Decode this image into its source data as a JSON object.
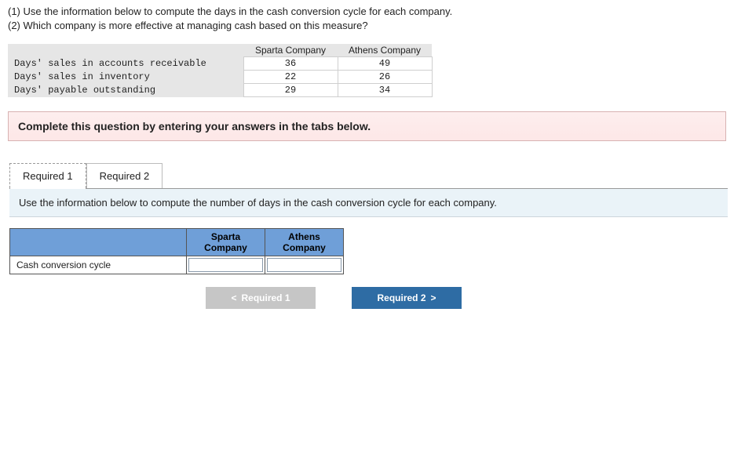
{
  "question": {
    "line1": "(1) Use the information below to compute the days in the cash conversion cycle for each company.",
    "line2": "(2) Which company is more effective at managing cash based on this measure?"
  },
  "dataTable": {
    "headers": {
      "col1": "Sparta Company",
      "col2": "Athens Company"
    },
    "rows": [
      {
        "label": "Days' sales in accounts receivable",
        "c1": "36",
        "c2": "49"
      },
      {
        "label": "Days' sales in inventory",
        "c1": "22",
        "c2": "26"
      },
      {
        "label": "Days' payable outstanding",
        "c1": "29",
        "c2": "34"
      }
    ]
  },
  "instructionBar": "Complete this question by entering your answers in the tabs below.",
  "tabs": {
    "tab1": "Required 1",
    "tab2": "Required 2"
  },
  "panelText": "Use the information below to compute the number of days in the cash conversion cycle for each company.",
  "answerTable": {
    "headers": {
      "col1": "Sparta Company",
      "col2": "Athens Company"
    },
    "rowLabel": "Cash conversion cycle",
    "values": {
      "c1": "",
      "c2": ""
    }
  },
  "navButtons": {
    "prev": {
      "chevron": "<",
      "label": "Required 1"
    },
    "next": {
      "label": "Required 2",
      "chevron": ">"
    }
  }
}
